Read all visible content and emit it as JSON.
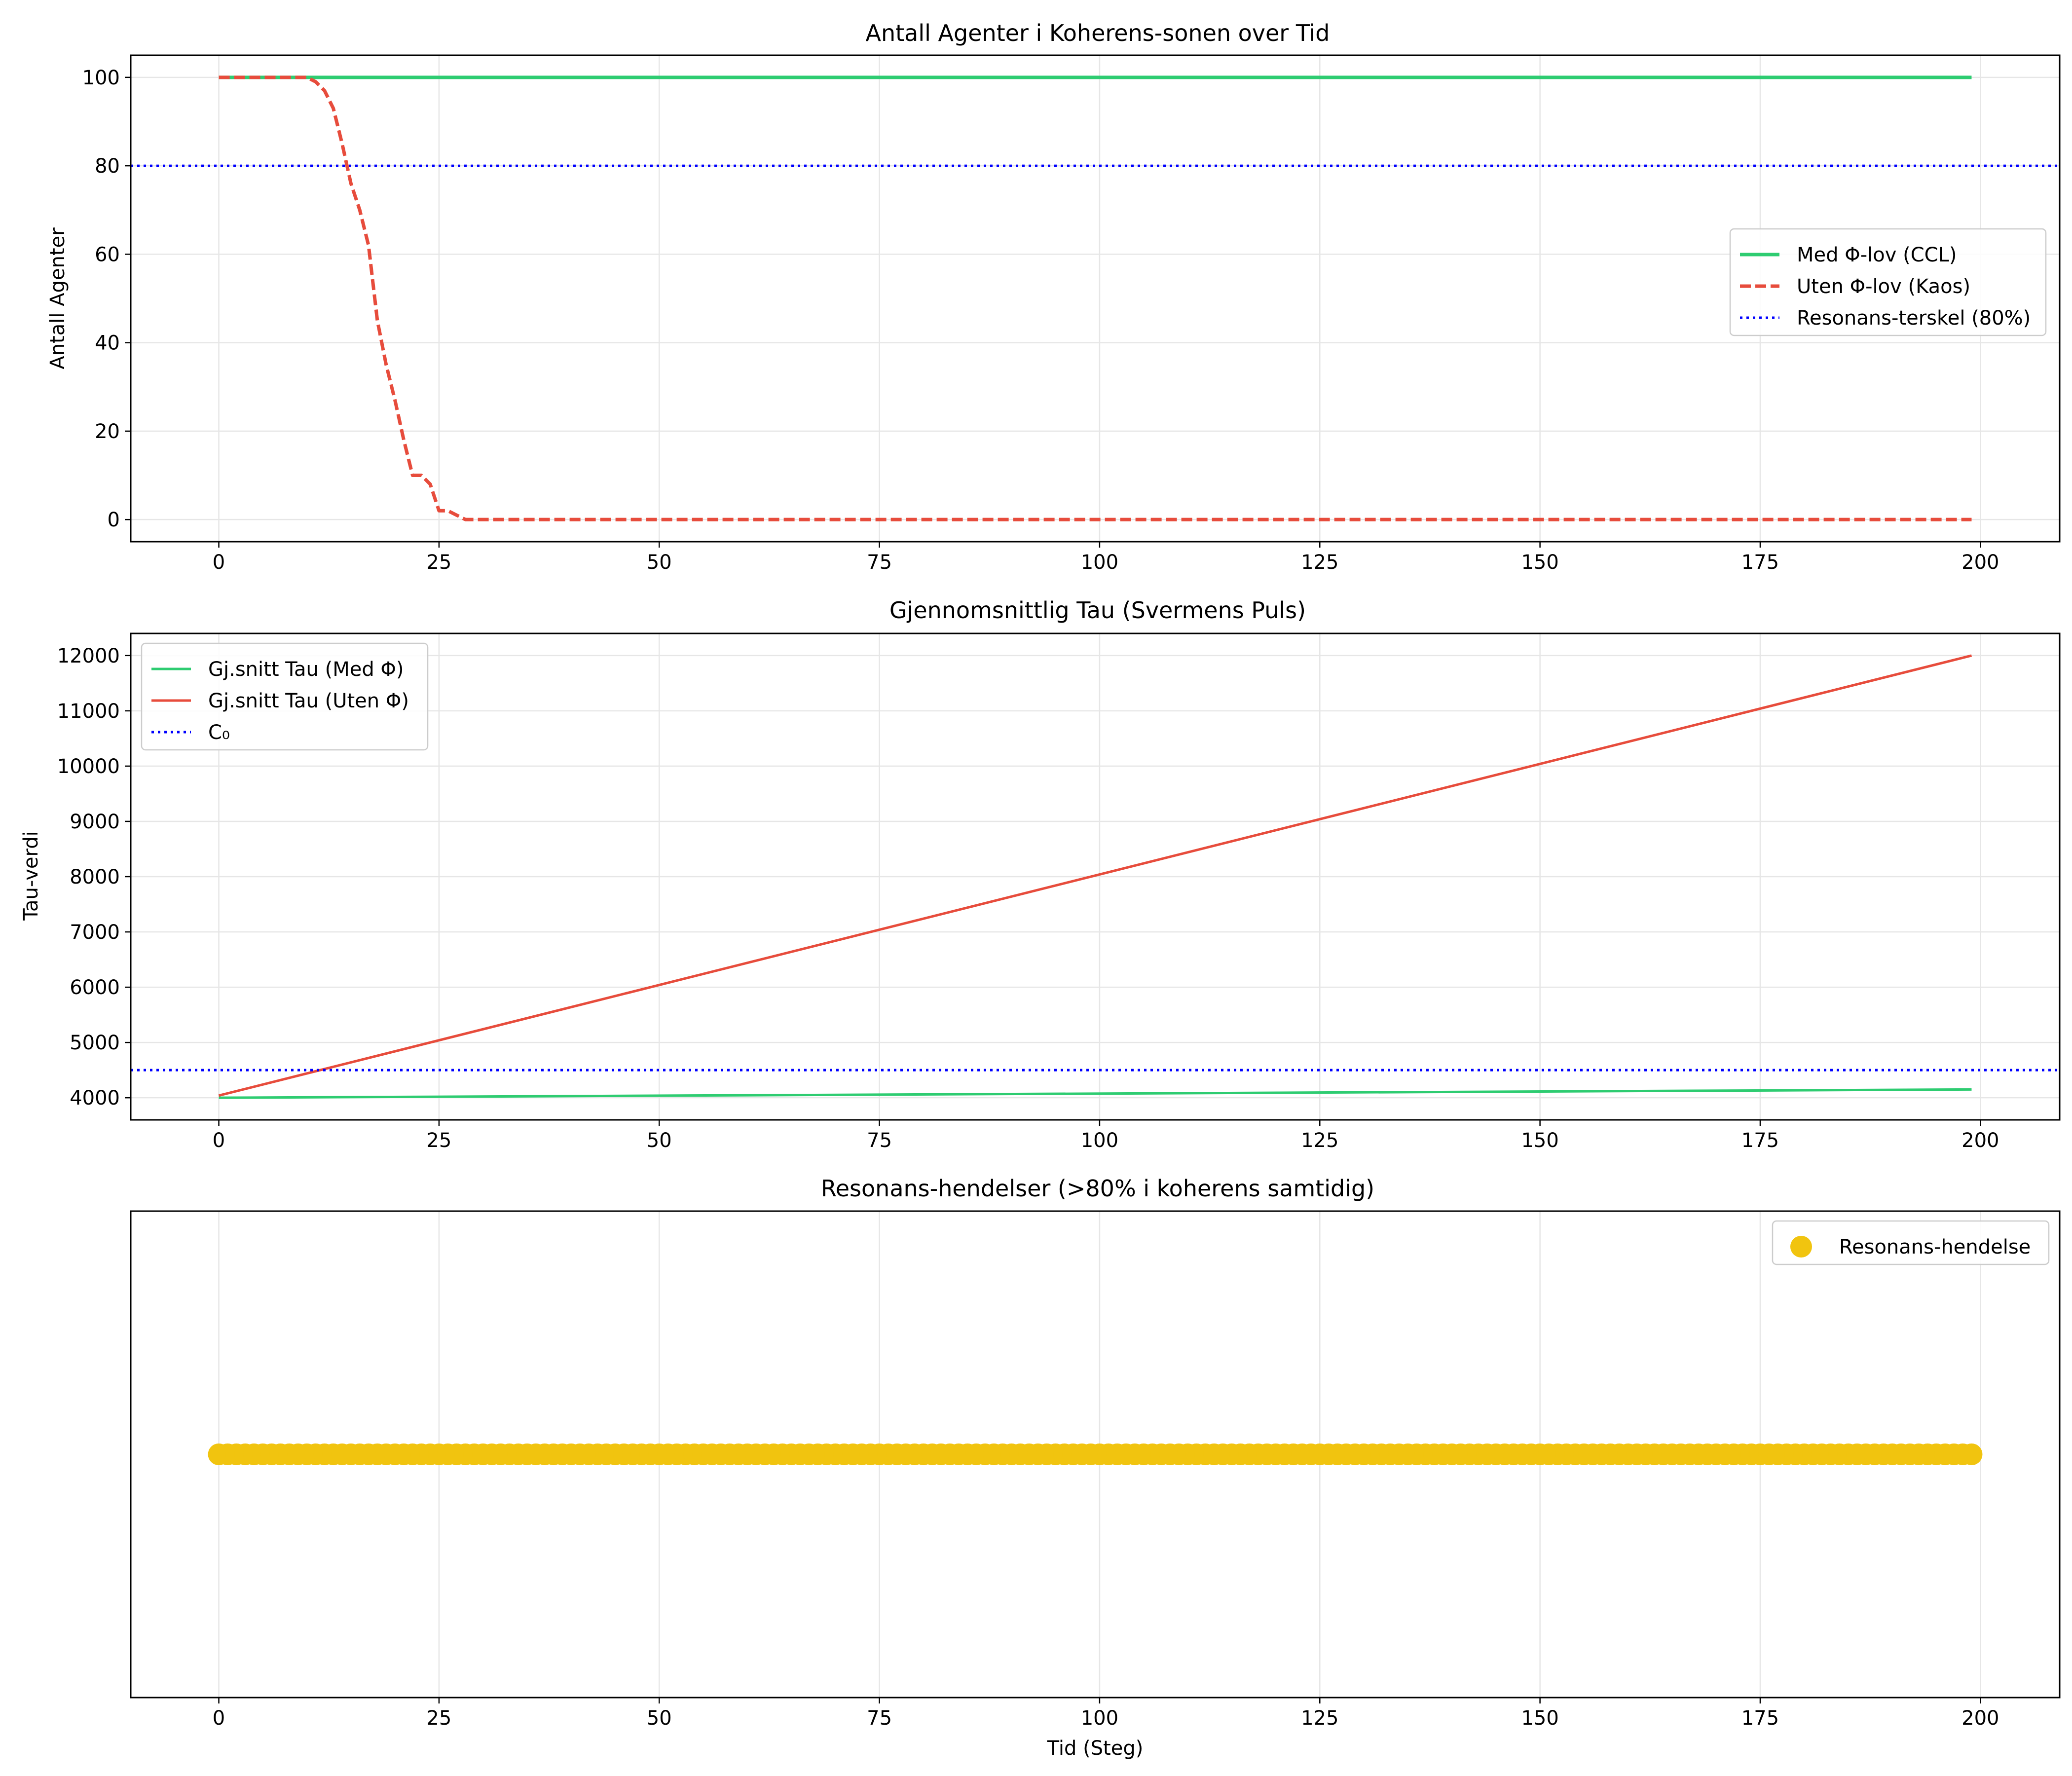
{
  "figure": {
    "xlabel": "Tid (Steg)"
  },
  "chart_data": [
    {
      "type": "line",
      "title": "Antall Agenter i Koherens-sonen over Tid",
      "xlabel": "",
      "ylabel": "Antall Agenter",
      "xlim": [
        -10,
        209
      ],
      "ylim": [
        -5,
        105
      ],
      "xticks": [
        "0",
        "25",
        "50",
        "75",
        "100",
        "125",
        "150",
        "175",
        "200"
      ],
      "yticks": [
        "0",
        "20",
        "40",
        "60",
        "80",
        "100"
      ],
      "grid": true,
      "legend_position": "center-right",
      "series": [
        {
          "name": "Med Φ-lov (CCL)",
          "style": "solid",
          "color": "#2ecc71",
          "x": [
            0,
            199
          ],
          "y": [
            100,
            100
          ]
        },
        {
          "name": "Uten Φ-lov (Kaos)",
          "style": "dashed",
          "color": "#e74c3c",
          "x": [
            0,
            10,
            11,
            12,
            13,
            14,
            15,
            16,
            17,
            18,
            19,
            20,
            21,
            22,
            23,
            24,
            25,
            26,
            27,
            28,
            199
          ],
          "y": [
            100,
            100,
            99,
            97,
            93,
            85,
            76,
            70,
            62,
            45,
            35,
            27,
            18,
            10,
            10,
            8,
            2,
            2,
            1,
            0,
            0
          ]
        },
        {
          "name": "Resonans-terskel (80%)",
          "style": "dotted",
          "color": "#0000ff",
          "hline": 80
        }
      ]
    },
    {
      "type": "line",
      "title": "Gjennomsnittlig Tau (Svermens Puls)",
      "xlabel": "",
      "ylabel": "Tau-verdi",
      "xlim": [
        -10,
        209
      ],
      "ylim": [
        3600,
        12400
      ],
      "xticks": [
        "0",
        "25",
        "50",
        "75",
        "100",
        "125",
        "150",
        "175",
        "200"
      ],
      "yticks": [
        "4000",
        "5000",
        "6000",
        "7000",
        "8000",
        "9000",
        "10000",
        "11000",
        "12000"
      ],
      "grid": true,
      "legend_position": "upper-left",
      "series": [
        {
          "name": "Gj.snitt Tau (Med Φ)",
          "style": "solid",
          "color": "#2ecc71",
          "x": [
            0,
            199
          ],
          "y": [
            4000,
            4150
          ]
        },
        {
          "name": "Gj.snitt Tau (Uten Φ)",
          "style": "solid",
          "color": "#e74c3c",
          "x": [
            0,
            199
          ],
          "y": [
            4040,
            12000
          ]
        },
        {
          "name": "C₀",
          "style": "dotted",
          "color": "#0000ff",
          "hline": 4500
        }
      ]
    },
    {
      "type": "scatter",
      "title": "Resonans-hendelser (>80% i koherens samtidig)",
      "xlabel": "Tid (Steg)",
      "ylabel": "",
      "xlim": [
        -10,
        209
      ],
      "ylim": [
        0,
        2
      ],
      "xticks": [
        "0",
        "25",
        "50",
        "75",
        "100",
        "125",
        "150",
        "175",
        "200"
      ],
      "yticks": [],
      "grid": true,
      "legend_position": "upper-right",
      "series": [
        {
          "name": "Resonans-hendelse",
          "color": "#f1c40f",
          "x_range": [
            0,
            199
          ],
          "y": 1
        }
      ]
    }
  ]
}
